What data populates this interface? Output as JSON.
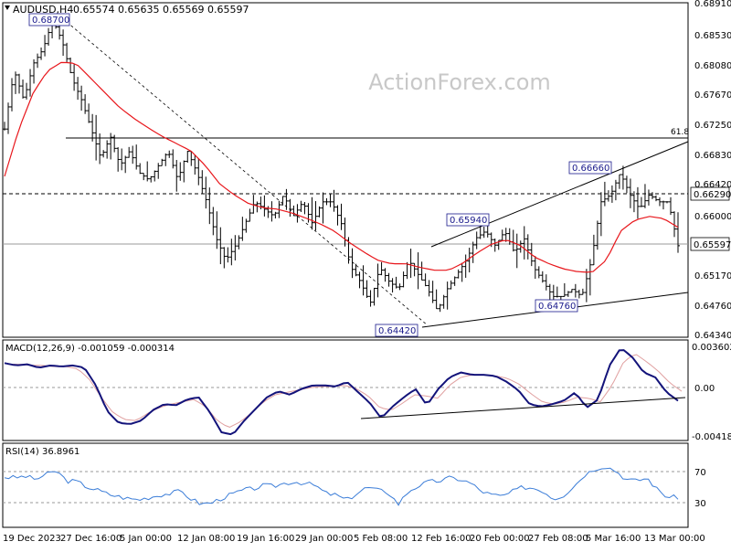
{
  "symbol": "AUDUSD,H4",
  "ohlc": "0.65574 0.65635 0.65569 0.65597",
  "watermark": "ActionForex.com",
  "chart_data": [
    {
      "type": "line",
      "panel": "price",
      "ylim": [
        0.6434,
        0.6891
      ],
      "y_ticks": [
        "0.68910",
        "0.68530",
        "0.68080",
        "0.67670",
        "0.67250",
        "0.66830",
        "0.66420",
        "0.66000",
        "0.65170",
        "0.64760",
        "0.64340"
      ],
      "price_tags": [
        {
          "label": "0.66290",
          "value": 0.6629,
          "style": "dashed"
        },
        {
          "label": "0.65597",
          "value": 0.65597,
          "style": "solid"
        }
      ],
      "x_labels": [
        "19 Dec 2023",
        "27 Dec 16:00",
        "5 Jan 00:00",
        "12 Jan 08:00",
        "19 Jan 16:00",
        "29 Jan 00:00",
        "5 Feb 08:00",
        "12 Feb 16:00",
        "20 Feb 00:00",
        "27 Feb 08:00",
        "5 Mar 16:00",
        "13 Mar 00:00"
      ],
      "fib_label": "61.8",
      "fib_level": 0.6706,
      "annotations": [
        {
          "label": "0.68700",
          "value": 0.687
        },
        {
          "label": "0.64420",
          "value": 0.6442
        },
        {
          "label": "0.65940",
          "value": 0.6594
        },
        {
          "label": "0.64760",
          "value": 0.6476
        },
        {
          "label": "0.66660",
          "value": 0.6666
        }
      ],
      "close_series": [
        0.672,
        0.68,
        0.676,
        0.681,
        0.683,
        0.687,
        0.684,
        0.679,
        0.676,
        0.672,
        0.668,
        0.671,
        0.667,
        0.669,
        0.666,
        0.665,
        0.667,
        0.669,
        0.665,
        0.669,
        0.666,
        0.662,
        0.657,
        0.654,
        0.656,
        0.659,
        0.662,
        0.661,
        0.66,
        0.663,
        0.66,
        0.662,
        0.659,
        0.662,
        0.662,
        0.659,
        0.653,
        0.651,
        0.648,
        0.653,
        0.651,
        0.65,
        0.654,
        0.652,
        0.65,
        0.647,
        0.65,
        0.652,
        0.654,
        0.657,
        0.658,
        0.656,
        0.658,
        0.655,
        0.657,
        0.653,
        0.651,
        0.649,
        0.649,
        0.65,
        0.649,
        0.654,
        0.662,
        0.663,
        0.666,
        0.663,
        0.661,
        0.663,
        0.662,
        0.662,
        0.65597
      ],
      "ma_series": [
        0.6655,
        0.672,
        0.677,
        0.68,
        0.6812,
        0.681,
        0.679,
        0.677,
        0.675,
        0.6735,
        0.6722,
        0.671,
        0.67,
        0.669,
        0.667,
        0.6645,
        0.663,
        0.6618,
        0.6612,
        0.661,
        0.6605,
        0.6598,
        0.659,
        0.658,
        0.6565,
        0.6552,
        0.654,
        0.6535,
        0.6535,
        0.653,
        0.6526,
        0.6526,
        0.6536,
        0.655,
        0.6562,
        0.6568,
        0.656,
        0.6544,
        0.6535,
        0.6528,
        0.6524,
        0.6523,
        0.654,
        0.658,
        0.6595,
        0.66,
        0.6597,
        0.6585
      ]
    },
    {
      "type": "line",
      "panel": "macd",
      "label": "MACD(12,26,9) -0.001059 -0.000314",
      "ylim": [
        -0.004188,
        0.003602
      ],
      "y_ticks": [
        "0.003602",
        "0.00",
        "-0.004188"
      ],
      "macd_series": [
        0.0021,
        0.0019,
        0.002,
        0.0017,
        0.0019,
        0.0018,
        0.0019,
        0.0017,
        0.0002,
        -0.002,
        -0.003,
        -0.0031,
        -0.0028,
        -0.0019,
        -0.0014,
        -0.0015,
        -0.001,
        -0.0008,
        -0.0021,
        -0.0038,
        -0.004,
        -0.0028,
        -0.0018,
        -0.0008,
        -0.0003,
        -0.0006,
        -0.0001,
        0.0002,
        0.0002,
        0.0001,
        0.0005,
        -0.0004,
        -0.0013,
        -0.0026,
        -0.0016,
        -0.0008,
        -0.0001,
        -0.0015,
        -0.0001,
        0.0009,
        0.0013,
        0.0011,
        0.0011,
        0.001,
        0.0005,
        -0.0002,
        -0.0014,
        -0.0016,
        -0.0014,
        -0.0011,
        -0.0004,
        -0.0017,
        -0.001,
        0.0019,
        0.0034,
        0.0026,
        0.0013,
        0.0009,
        -0.0004,
        -0.0011
      ],
      "signal_series": [
        0.002,
        0.002,
        0.0019,
        0.0019,
        0.0018,
        0.0018,
        0.0016,
        0.0007,
        -0.0008,
        -0.0021,
        -0.0027,
        -0.0028,
        -0.0022,
        -0.0017,
        -0.0014,
        -0.0012,
        -0.001,
        -0.0016,
        -0.0028,
        -0.0034,
        -0.0029,
        -0.0021,
        -0.0012,
        -0.0006,
        -0.0004,
        -0.0002,
        0.0,
        0.0001,
        0.0001,
        0.0002,
        -0.0001,
        -0.0007,
        -0.0017,
        -0.0019,
        -0.0013,
        -0.0006,
        -0.0007,
        -0.0009,
        0.0002,
        0.0009,
        0.0011,
        0.0011,
        0.001,
        0.0008,
        0.0003,
        -0.0005,
        -0.0012,
        -0.0014,
        -0.0012,
        -0.0008,
        -0.0009,
        -0.0012,
        0.0002,
        0.0022,
        0.0029,
        0.0022,
        0.0014,
        0.0004,
        -0.0003
      ]
    },
    {
      "type": "line",
      "panel": "rsi",
      "label": "RSI(14) 36.8961",
      "ylim": [
        0,
        100
      ],
      "y_ticks": [
        "70",
        "50",
        "30"
      ],
      "rsi_series": [
        63,
        62,
        64,
        60,
        66,
        71,
        58,
        57,
        50,
        46,
        41,
        38,
        35,
        34,
        37,
        40,
        42,
        45,
        35,
        28,
        30,
        36,
        41,
        46,
        48,
        52,
        51,
        55,
        57,
        55,
        52,
        42,
        40,
        33,
        42,
        50,
        46,
        44,
        28,
        45,
        52,
        57,
        58,
        62,
        60,
        55,
        45,
        40,
        38,
        44,
        50,
        49,
        45,
        35,
        40,
        52,
        66,
        74,
        77,
        71,
        60,
        58,
        62,
        47,
        37,
        37
      ]
    }
  ]
}
